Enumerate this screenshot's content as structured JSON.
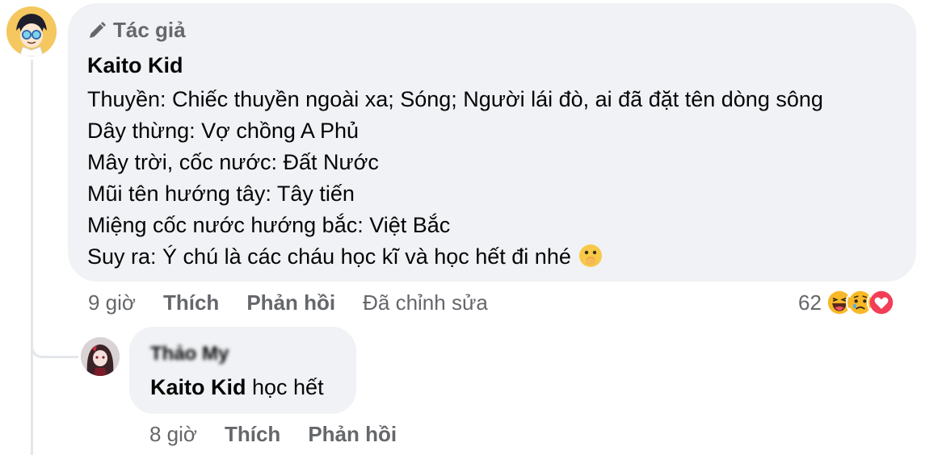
{
  "comment": {
    "badge_label": "Tác giả",
    "author": "Kaito Kid",
    "lines": [
      "Thuyền: Chiếc thuyền ngoài xa; Sóng; Người lái đò, ai đã đặt tên dòng sông",
      "Dây thừng: Vợ chồng A Phủ",
      "Mây trời, cốc nước: Đất Nước",
      "Mũi tên hướng tây: Tây tiến",
      "Miệng cốc nước hướng bắc: Việt Bắc",
      "Suy ra: Ý chú là các cháu học kĩ và học hết đi nhé"
    ],
    "trailing_emoji": "face-with-open-eyes-and-hand-over-mouth-icon",
    "time": "9 giờ",
    "like_label": "Thích",
    "reply_label": "Phản hồi",
    "edited_label": "Đã chỉnh sửa",
    "reaction_count": "62",
    "reactions": [
      "haha-icon",
      "sad-icon",
      "love-icon"
    ]
  },
  "reply": {
    "author": "Thảo My",
    "mention": "Kaito Kid",
    "text": " học hết",
    "time": "8 giờ",
    "like_label": "Thích",
    "reply_label": "Phản hồi"
  },
  "colors": {
    "bubble_bg": "#f0f2f5",
    "secondary_text": "#65676b",
    "primary_text": "#050505",
    "love_red": "#f33e58",
    "haha_yellow": "#f7b928"
  }
}
